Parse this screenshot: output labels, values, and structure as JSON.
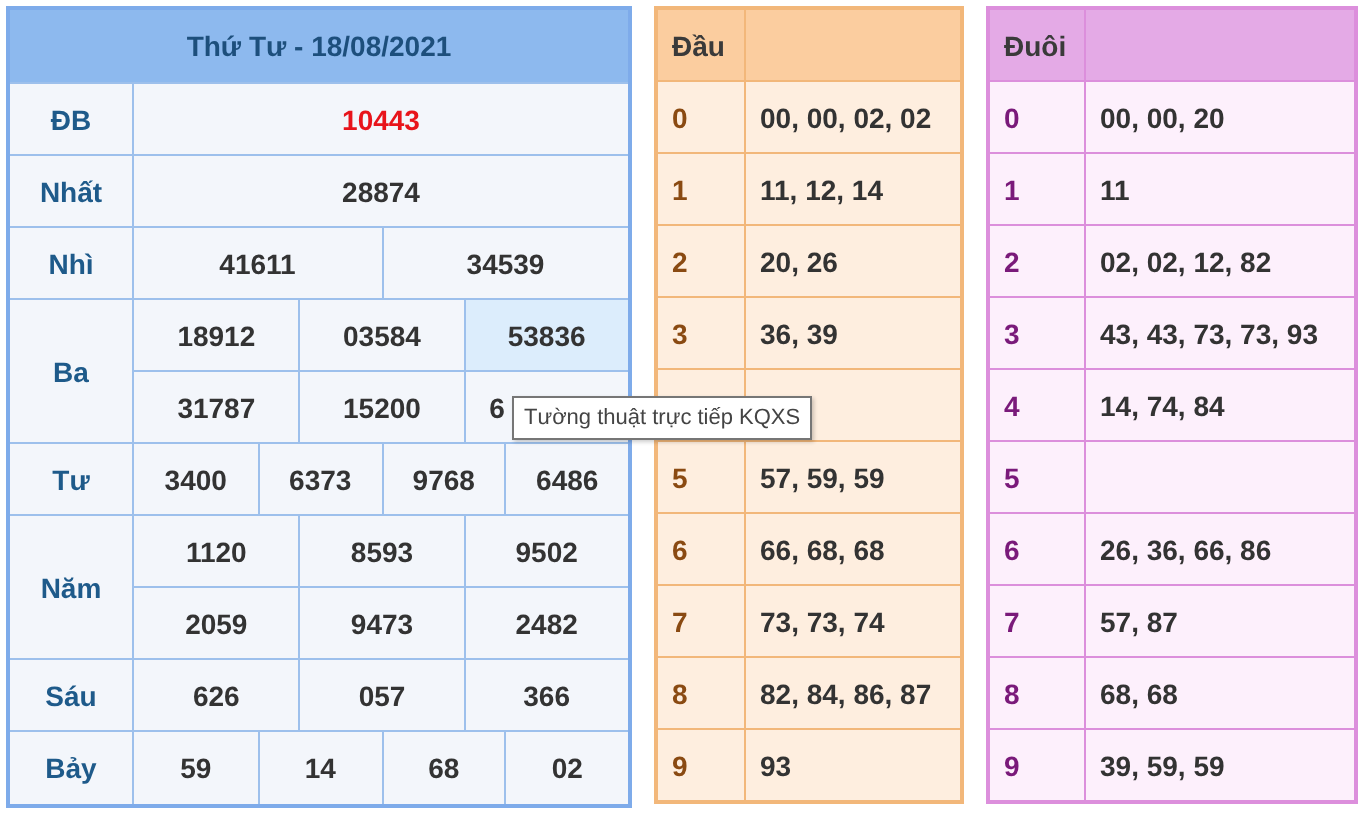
{
  "results": {
    "title": "Thứ Tư - 18/08/2021",
    "prizes": [
      {
        "label": "ĐB",
        "kind": "special",
        "rows": [
          [
            {
              "value": "10443",
              "highlighted": false
            }
          ]
        ]
      },
      {
        "label": "Nhất",
        "kind": "normal",
        "rows": [
          [
            {
              "value": "28874",
              "highlighted": false
            }
          ]
        ]
      },
      {
        "label": "Nhì",
        "kind": "normal",
        "rows": [
          [
            {
              "value": "41611",
              "highlighted": false
            },
            {
              "value": "34539",
              "highlighted": false
            }
          ]
        ]
      },
      {
        "label": "Ba",
        "kind": "normal",
        "rows": [
          [
            {
              "value": "18912",
              "highlighted": false
            },
            {
              "value": "03584",
              "highlighted": false
            },
            {
              "value": "53836",
              "highlighted": true
            }
          ],
          [
            {
              "value": "31787",
              "highlighted": false
            },
            {
              "value": "15200",
              "highlighted": false
            },
            {
              "value": "6",
              "highlighted": false,
              "cut": true
            }
          ]
        ]
      },
      {
        "label": "Tư",
        "kind": "normal",
        "rows": [
          [
            {
              "value": "3400",
              "highlighted": false
            },
            {
              "value": "6373",
              "highlighted": false
            },
            {
              "value": "9768",
              "highlighted": false
            },
            {
              "value": "6486",
              "highlighted": false
            }
          ]
        ]
      },
      {
        "label": "Năm",
        "kind": "normal",
        "rows": [
          [
            {
              "value": "1120",
              "highlighted": false
            },
            {
              "value": "8593",
              "highlighted": false
            },
            {
              "value": "9502",
              "highlighted": false
            }
          ],
          [
            {
              "value": "2059",
              "highlighted": false
            },
            {
              "value": "9473",
              "highlighted": false
            },
            {
              "value": "2482",
              "highlighted": false
            }
          ]
        ]
      },
      {
        "label": "Sáu",
        "kind": "normal",
        "rows": [
          [
            {
              "value": "626",
              "highlighted": false
            },
            {
              "value": "057",
              "highlighted": false
            },
            {
              "value": "366",
              "highlighted": false
            }
          ]
        ]
      },
      {
        "label": "Bảy",
        "kind": "normal",
        "rows": [
          [
            {
              "value": "59",
              "highlighted": false
            },
            {
              "value": "14",
              "highlighted": false
            },
            {
              "value": "68",
              "highlighted": false
            },
            {
              "value": "02",
              "highlighted": false
            }
          ]
        ]
      }
    ]
  },
  "head_table": {
    "title": "Đầu",
    "kind": "head",
    "rows": [
      {
        "digit": "0",
        "values": "00, 00, 02, 02"
      },
      {
        "digit": "1",
        "values": "11, 12, 14"
      },
      {
        "digit": "2",
        "values": "20, 26"
      },
      {
        "digit": "3",
        "values": "36, 39"
      },
      {},
      {
        "digit": "5",
        "values": "57, 59, 59"
      },
      {
        "digit": "6",
        "values": "66, 68, 68"
      },
      {
        "digit": "7",
        "values": "73, 73, 74"
      },
      {
        "digit": "8",
        "values": "82, 84, 86, 87"
      },
      {
        "digit": "9",
        "values": "93"
      }
    ]
  },
  "tail_table": {
    "title": "Đuôi",
    "kind": "tail",
    "rows": [
      {
        "digit": "0",
        "values": "00, 00, 20"
      },
      {
        "digit": "1",
        "values": "11"
      },
      {
        "digit": "2",
        "values": "02, 02, 12, 82"
      },
      {
        "digit": "3",
        "values": "43, 43, 73, 73, 93"
      },
      {
        "digit": "4",
        "values": "14, 74, 84"
      },
      {
        "digit": "5"
      },
      {
        "digit": "6",
        "values": "26, 36, 66, 86"
      },
      {
        "digit": "7",
        "values": "57, 87"
      },
      {
        "digit": "8",
        "values": "68, 68"
      },
      {
        "digit": "9",
        "values": "39, 59, 59"
      }
    ]
  },
  "tooltip": {
    "text": "Tường thuật trực tiếp KQXS"
  }
}
